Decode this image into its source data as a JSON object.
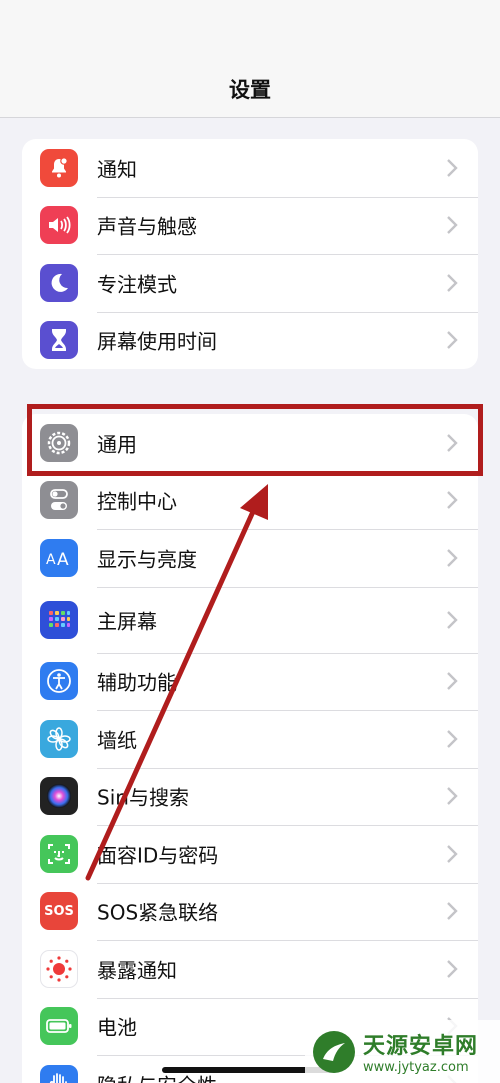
{
  "nav": {
    "title": "设置"
  },
  "group1": [
    {
      "label": "通知",
      "icon": "notification-bell-icon",
      "color": "#f04a3b"
    },
    {
      "label": "声音与触感",
      "icon": "speaker-icon",
      "color": "#ef3f55"
    },
    {
      "label": "专注模式",
      "icon": "moon-icon",
      "color": "#5a4fd0"
    },
    {
      "label": "屏幕使用时间",
      "icon": "hourglass-icon",
      "color": "#5a4fd0"
    }
  ],
  "group2": [
    {
      "label": "通用",
      "icon": "gear-icon",
      "color": "#8e8e93"
    },
    {
      "label": "控制中心",
      "icon": "toggles-icon",
      "color": "#8e8e93"
    },
    {
      "label": "显示与亮度",
      "icon": "text-size-icon",
      "color": "#2f7cf0"
    },
    {
      "label": "主屏幕",
      "icon": "app-grid-icon",
      "color": "#2e4fd8"
    },
    {
      "label": "辅助功能",
      "icon": "accessibility-icon",
      "color": "#2f7cf0"
    },
    {
      "label": "墙纸",
      "icon": "flower-icon",
      "color": "#39a8de"
    },
    {
      "label": "Siri与搜索",
      "icon": "siri-icon",
      "color": "#222222"
    },
    {
      "label": "面容ID与密码",
      "icon": "face-id-icon",
      "color": "#45c65a"
    },
    {
      "label": "SOS紧急联络",
      "icon": "sos-icon",
      "color": "#e8453a",
      "icon_text": "SOS"
    },
    {
      "label": "暴露通知",
      "icon": "exposure-icon",
      "color": "#ffffff"
    },
    {
      "label": "电池",
      "icon": "battery-icon",
      "color": "#45c65a"
    },
    {
      "label": "隐私与安全性",
      "icon": "privacy-hand-icon",
      "color": "#2f7cf0"
    }
  ],
  "annotation": {
    "color": "#b01d1d"
  },
  "watermark": {
    "name": "天源安卓网",
    "url": "www.jytyaz.com"
  }
}
